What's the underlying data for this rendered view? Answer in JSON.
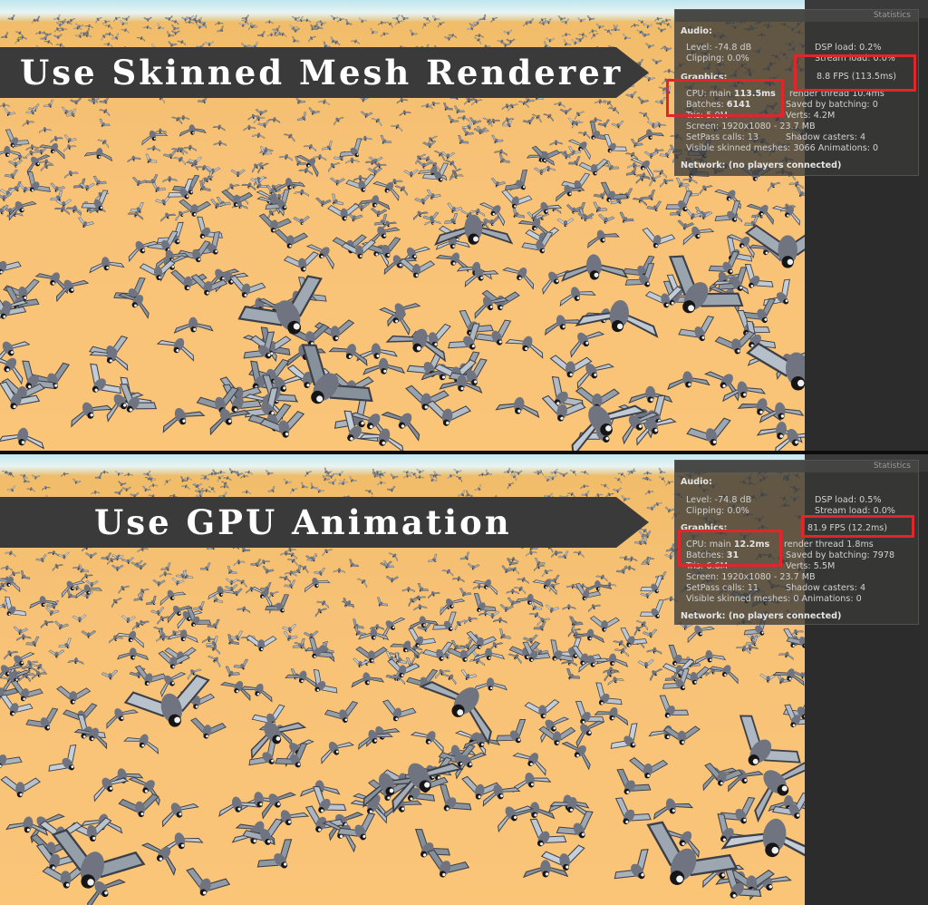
{
  "panels": [
    {
      "caption": "Use Skinned Mesh Renderer",
      "stats": {
        "title": "Statistics",
        "audio_heading": "Audio:",
        "level": "Level: -74.8 dB",
        "clipping": "Clipping: 0.0%",
        "dsp_load": "DSP load: 0.2%",
        "stream_load": "Stream load: 0.0%",
        "graphics_heading": "Graphics:",
        "fps": "8.8 FPS (113.5ms)",
        "cpu_label": "CPU: main ",
        "cpu_main": "113.5ms",
        "render_thread": "render thread 10.4ms",
        "batches_label": "Batches: ",
        "batches": "6141",
        "saved_by_batching": "Saved by batching: 0",
        "tris": "Tris: 5.0M",
        "verts": "Verts: 4.2M",
        "screen": "Screen: 1920x1080 - 23.7 MB",
        "setpass": "SetPass calls: 13",
        "shadow_casters": "Shadow casters: 4",
        "skinned": "Visible skinned meshes: 3066  Animations: 0",
        "network": "Network: (no players connected)"
      }
    },
    {
      "caption": "Use GPU Animation",
      "stats": {
        "title": "Statistics",
        "audio_heading": "Audio:",
        "level": "Level: -74.8 dB",
        "clipping": "Clipping: 0.0%",
        "dsp_load": "DSP load: 0.5%",
        "stream_load": "Stream load: 0.0%",
        "graphics_heading": "Graphics:",
        "fps": "81.9 FPS (12.2ms)",
        "cpu_label": "CPU: main ",
        "cpu_main": "12.2ms",
        "render_thread": "render thread 1.8ms",
        "batches_label": "Batches: ",
        "batches": "31",
        "saved_by_batching": "Saved by batching: 7978",
        "tris": "Tris: 6.6M",
        "verts": "Verts: 5.5M",
        "screen": "Screen: 1920x1080 - 23.7 MB",
        "setpass": "SetPass calls: 11",
        "shadow_casters": "Shadow casters: 4",
        "skinned": "Visible skinned meshes: 0  Animations: 0",
        "network": "Network: (no players connected)"
      }
    }
  ],
  "colors": {
    "sand": "#f7c277",
    "banner": "#3a3a3a",
    "highlight": "#e0262b",
    "editor_dark": "#2c2c2c"
  }
}
